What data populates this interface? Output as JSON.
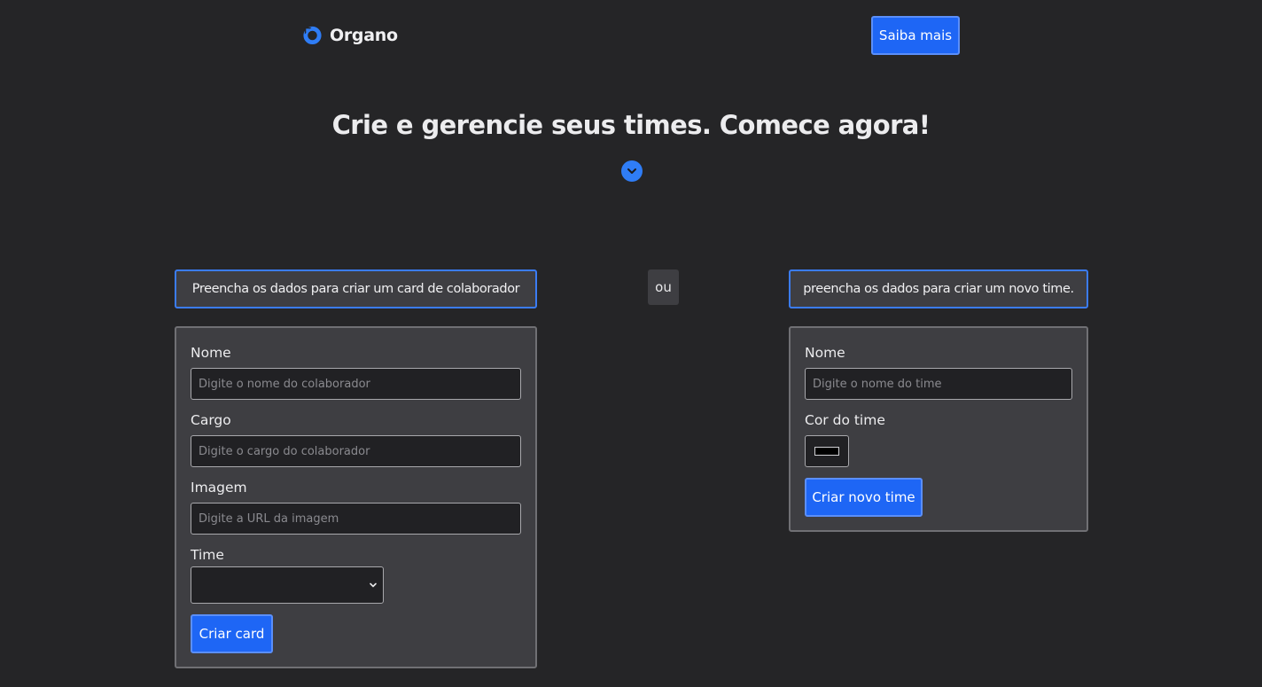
{
  "header": {
    "brand": "Organo",
    "saiba_mais_label": "Saiba mais"
  },
  "hero": {
    "headline": "Crie e gerencie seus times. Comece agora!"
  },
  "hints": {
    "left": "Preencha os dados para criar um card de colaborador",
    "separator": "ou",
    "right": "preencha os dados para criar um novo time."
  },
  "collaborator_form": {
    "name_label": "Nome",
    "name_placeholder": "Digite o nome do colaborador",
    "role_label": "Cargo",
    "role_placeholder": "Digite o cargo do colaborador",
    "image_label": "Imagem",
    "image_placeholder": "Digite a URL da imagem",
    "team_label": "Time",
    "team_selected": "",
    "submit_label": "Criar card"
  },
  "team_form": {
    "name_label": "Nome",
    "name_placeholder": "Digite o nome do time",
    "color_label": "Cor do time",
    "color_value": "#000000",
    "submit_label": "Criar novo time"
  },
  "colors": {
    "background": "#252527",
    "panel": "#3e3e42",
    "accent": "#1e66f5",
    "icon_blue": "#2f7df6"
  }
}
